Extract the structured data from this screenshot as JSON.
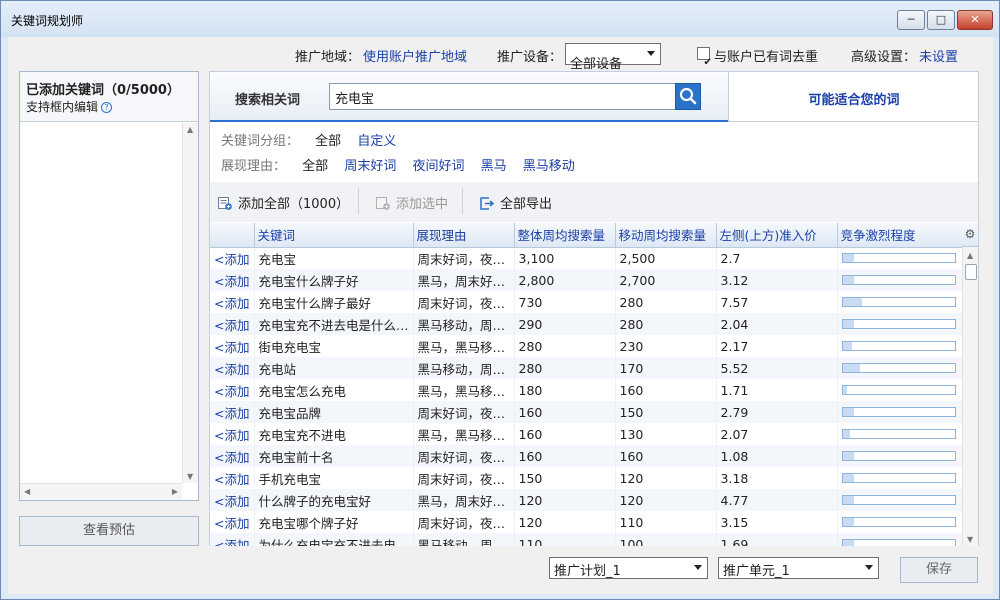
{
  "window": {
    "title": "关键词规划师",
    "min": "─",
    "max": "□",
    "close": "✕"
  },
  "top": {
    "region_label": "推广地域：",
    "region_value": "使用账户推广地域",
    "device_label": "推广设备：",
    "device_value": "全部设备",
    "dedupe_checked": true,
    "dedupe_label": "与账户已有词去重",
    "advanced_label": "高级设置：",
    "advanced_value": "未设置"
  },
  "left": {
    "title": "已添加关键词（0/5000）",
    "subtitle": "支持框内编辑",
    "help": "?",
    "preview_btn": "查看预估"
  },
  "search": {
    "label": "搜索相关词",
    "value": "充电宝",
    "suggest_label": "可能适合您的词"
  },
  "filters": {
    "group_label": "关键词分组：",
    "group_options": [
      "全部",
      "自定义"
    ],
    "reason_label": "展现理由：",
    "reason_options": [
      "全部",
      "周末好词",
      "夜间好词",
      "黑马",
      "黑马移动"
    ]
  },
  "toolbar": {
    "add_all": "添加全部（1000）",
    "add_selected": "添加选中",
    "export_all": "全部导出"
  },
  "table": {
    "headers": [
      "",
      "关键词",
      "展现理由",
      "整体周均搜索量",
      "移动周均搜索量",
      "左侧(上方)准入价",
      "竞争激烈程度"
    ],
    "add_label": "<添加",
    "rows": [
      {
        "kw": "充电宝",
        "reason": "周末好词，夜…",
        "total": "3,100",
        "mobile": "2,500",
        "price": "2.7",
        "comp": 0.1
      },
      {
        "kw": "充电宝什么牌子好",
        "reason": "黑马，周末好…",
        "total": "2,800",
        "mobile": "2,700",
        "price": "3.12",
        "comp": 0.1
      },
      {
        "kw": "充电宝什么牌子最好",
        "reason": "周末好词，夜…",
        "total": "730",
        "mobile": "280",
        "price": "7.57",
        "comp": 0.17
      },
      {
        "kw": "充电宝充不进去电是什么…",
        "reason": "黑马移动，周…",
        "total": "290",
        "mobile": "280",
        "price": "2.04",
        "comp": 0.1
      },
      {
        "kw": "街电充电宝",
        "reason": "黑马，黑马移…",
        "total": "280",
        "mobile": "230",
        "price": "2.17",
        "comp": 0.08
      },
      {
        "kw": "充电站",
        "reason": "黑马移动，周…",
        "total": "280",
        "mobile": "170",
        "price": "5.52",
        "comp": 0.15
      },
      {
        "kw": "充电宝怎么充电",
        "reason": "黑马，黑马移…",
        "total": "180",
        "mobile": "160",
        "price": "1.71",
        "comp": 0.04
      },
      {
        "kw": "充电宝品牌",
        "reason": "周末好词，夜…",
        "total": "160",
        "mobile": "150",
        "price": "2.79",
        "comp": 0.1
      },
      {
        "kw": "充电宝充不进电",
        "reason": "黑马，黑马移…",
        "total": "160",
        "mobile": "130",
        "price": "2.07",
        "comp": 0.06
      },
      {
        "kw": "充电宝前十名",
        "reason": "周末好词，夜…",
        "total": "160",
        "mobile": "160",
        "price": "1.08",
        "comp": 0.1
      },
      {
        "kw": "手机充电宝",
        "reason": "周末好词，夜…",
        "total": "150",
        "mobile": "120",
        "price": "3.18",
        "comp": 0.1
      },
      {
        "kw": "什么牌子的充电宝好",
        "reason": "黑马，周末好…",
        "total": "120",
        "mobile": "120",
        "price": "4.77",
        "comp": 0.1
      },
      {
        "kw": "充电宝哪个牌子好",
        "reason": "周末好词，夜…",
        "total": "120",
        "mobile": "110",
        "price": "3.15",
        "comp": 0.1
      },
      {
        "kw": "为什么充电宝充不进去电",
        "reason": "黑马移动，周…",
        "total": "110",
        "mobile": "100",
        "price": "1.69",
        "comp": 0.1
      }
    ]
  },
  "bottom": {
    "plan_value": "推广计划_1",
    "unit_value": "推广单元_1",
    "save_btn": "保存"
  },
  "colors": {
    "link": "#1b3fa6",
    "accent": "#2a73c8",
    "bar_border": "#8fb3dd",
    "bar_fill": "#c8dcf3"
  }
}
